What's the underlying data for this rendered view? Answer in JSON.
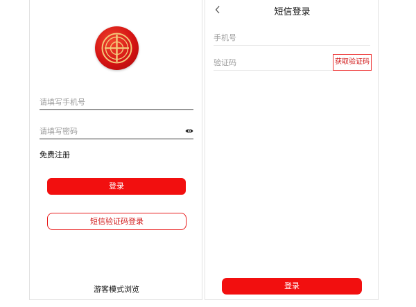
{
  "password_login": {
    "phone_placeholder": "请填写手机号",
    "password_placeholder": "请填写密码",
    "register_link": "免费注册",
    "login_button": "登录",
    "sms_login_button": "短信验证码登录",
    "guest_mode_link": "游客模式浏览",
    "icons": {
      "logo": "union-emblem-logo",
      "password_toggle": "eye-icon"
    }
  },
  "sms_login": {
    "title": "短信登录",
    "phone_placeholder": "手机号",
    "code_placeholder": "验证码",
    "get_code_button": "获取验证码",
    "login_button": "登录",
    "icons": {
      "back": "chevron-left-icon"
    }
  },
  "colors": {
    "accent": "#f20f0f",
    "accent_outline": "#e81b1b",
    "placeholder": "#9a9a9a"
  }
}
